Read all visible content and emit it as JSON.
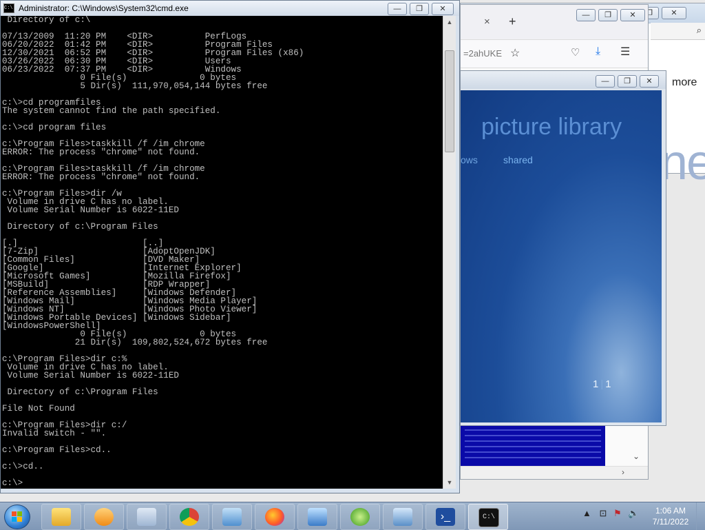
{
  "cmd": {
    "title": "Administrator: C:\\Windows\\System32\\cmd.exe",
    "icon_label": "C:\\",
    "output": [
      " Directory of c:\\",
      "",
      "07/13/2009  11:20 PM    <DIR>          PerfLogs",
      "06/20/2022  01:42 PM    <DIR>          Program Files",
      "12/30/2021  06:52 PM    <DIR>          Program Files (x86)",
      "03/26/2022  06:30 PM    <DIR>          Users",
      "06/23/2022  07:37 PM    <DIR>          Windows",
      "               0 File(s)              0 bytes",
      "               5 Dir(s)  111,970,054,144 bytes free",
      "",
      "c:\\>cd programfiles",
      "The system cannot find the path specified.",
      "",
      "c:\\>cd program files",
      "",
      "c:\\Program Files>taskkill /f /im chrome",
      "ERROR: The process \"chrome\" not found.",
      "",
      "c:\\Program Files>taskkill /f /im chrome",
      "ERROR: The process \"chrome\" not found.",
      "",
      "c:\\Program Files>dir /w",
      " Volume in drive C has no label.",
      " Volume Serial Number is 6022-11ED",
      "",
      " Directory of c:\\Program Files",
      "",
      "[.]                        [..]",
      "[7-Zip]                    [AdoptOpenJDK]",
      "[Common Files]             [DVD Maker]",
      "[Google]                   [Internet Explorer]",
      "[Microsoft Games]          [Mozilla Firefox]",
      "[MSBuild]                  [RDP Wrapper]",
      "[Reference Assemblies]     [Windows Defender]",
      "[Windows Mail]             [Windows Media Player]",
      "[Windows NT]               [Windows Photo Viewer]",
      "[Windows Portable Devices] [Windows Sidebar]",
      "[WindowsPowerShell]",
      "               0 File(s)              0 bytes",
      "              21 Dir(s)  109,802,524,672 bytes free",
      "",
      "c:\\Program Files>dir c:%",
      " Volume in drive C has no label.",
      " Volume Serial Number is 6022-11ED",
      "",
      " Directory of c:\\Program Files",
      "",
      "File Not Found",
      "",
      "c:\\Program Files>dir c:/",
      "Invalid switch - \"\".",
      "",
      "c:\\Program Files>cd..",
      "",
      "c:\\>cd..",
      "",
      "c:\\>"
    ]
  },
  "firefox": {
    "url_fragment": "=2ahUKE",
    "new_tab": "+",
    "close_tab": "×"
  },
  "background_page": {
    "more_link": "more",
    "big_text": "ne"
  },
  "picture_library": {
    "title": "picture library",
    "nav_left": "ows",
    "nav_shared": "shared",
    "counter_current": "1",
    "counter_total": "1"
  },
  "window_buttons": {
    "minimize": "—",
    "maximize": "❐",
    "close": "✕"
  },
  "taskbar": {
    "items": [
      "explorer",
      "media-player",
      "documents",
      "chrome",
      "control-panel",
      "firefox",
      "photo-viewer",
      "windows-update",
      "remote-desktop",
      "powershell",
      "cmd"
    ],
    "clock_time": "1:06 AM",
    "clock_date": "7/11/2022"
  },
  "colors": {
    "cmd_background": "#000000",
    "cmd_text": "#c0c0c0",
    "picture_library_blue": "#1c4d99"
  }
}
